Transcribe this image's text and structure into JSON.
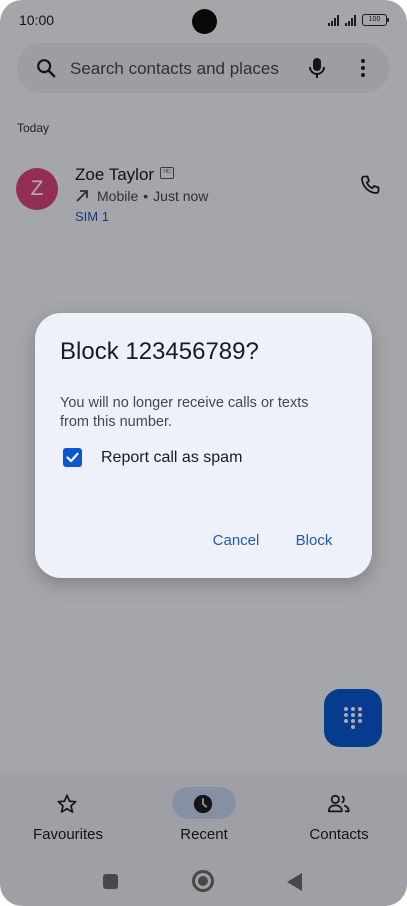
{
  "status_bar": {
    "time": "10:00",
    "battery": "100"
  },
  "search": {
    "placeholder": "Search contacts and places"
  },
  "section": {
    "today": "Today"
  },
  "call": {
    "avatar_letter": "Z",
    "name": "Zoe Taylor",
    "hd_badge": "HD",
    "type": "Mobile",
    "time": "Just now",
    "separator": "•",
    "sim": "SIM 1",
    "avatar_color": "#d8457c"
  },
  "dialog": {
    "title": "Block 123456789?",
    "body": "You will no longer receive calls or texts from this number.",
    "checkbox_label": "Report call as spam",
    "checkbox_checked": true,
    "cancel": "Cancel",
    "block": "Block"
  },
  "nav": [
    {
      "label": "Favourites",
      "icon": "star-icon",
      "active": false
    },
    {
      "label": "Recent",
      "icon": "clock-icon",
      "active": true
    },
    {
      "label": "Contacts",
      "icon": "people-icon",
      "active": false
    }
  ],
  "colors": {
    "accent": "#0b57d0",
    "link": "#1f5bb7"
  }
}
